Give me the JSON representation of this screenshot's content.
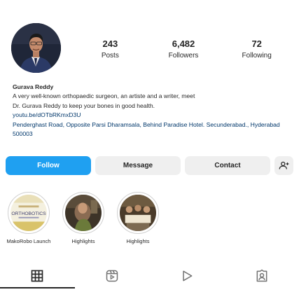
{
  "profile": {
    "name": "Gurava Reddy",
    "bio_lines": [
      "A very well-known orthopaedic surgeon, an artiste and a writer, meet",
      "Dr. Gurava Reddy to keep your bones in good health."
    ],
    "link": "youtu.be/dOTbRKmxD3U",
    "address": "Penderghast Road, Opposite Parsi Dharamsala, Behind Paradise Hotel. Secunderabad., Hyderabad 500003"
  },
  "stats": [
    {
      "value": "243",
      "label": "Posts"
    },
    {
      "value": "6,482",
      "label": "Followers"
    },
    {
      "value": "72",
      "label": "Following"
    }
  ],
  "actions": {
    "follow_label": "Follow",
    "message_label": "Message",
    "contact_label": "Contact"
  },
  "highlights": [
    {
      "label": "MakoRobo Launch",
      "icon": "orthobotics-cover",
      "cover_text": "ORTHOBOTICS"
    },
    {
      "label": "Highlights",
      "icon": "highlight-cover-1"
    },
    {
      "label": "Highlights",
      "icon": "highlight-cover-2"
    }
  ],
  "tabs": [
    {
      "name": "posts-grid-icon",
      "active": true
    },
    {
      "name": "reels-icon",
      "active": false
    },
    {
      "name": "video-play-icon",
      "active": false
    },
    {
      "name": "tagged-icon",
      "active": false
    }
  ],
  "colors": {
    "follow_button": "#1fa0f1",
    "secondary_button": "#efefef",
    "link": "#00376b",
    "text": "#262626"
  }
}
